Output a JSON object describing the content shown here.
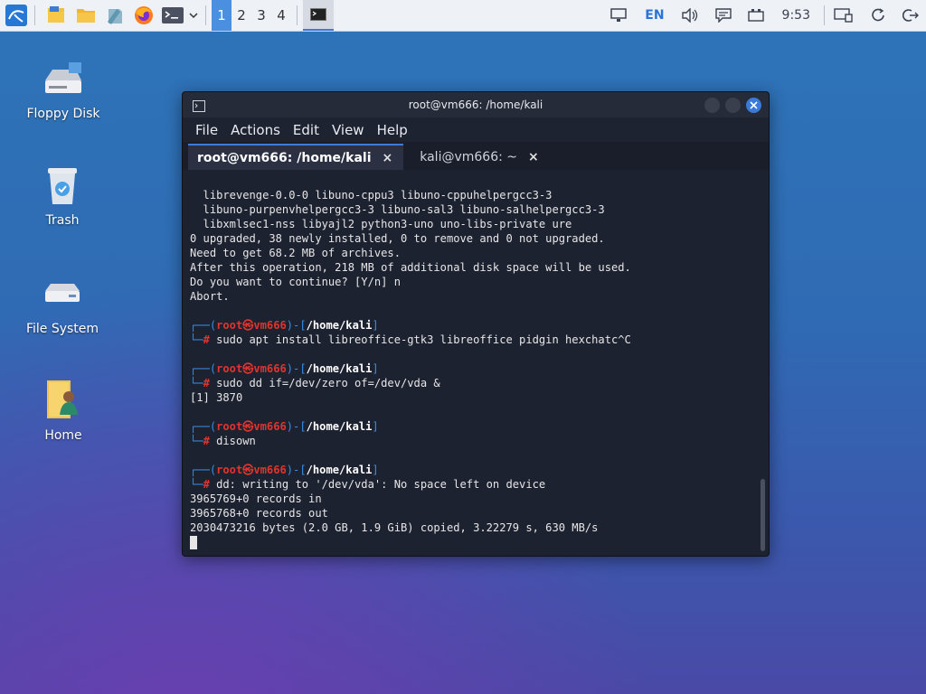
{
  "taskbar": {
    "workspaces": [
      "1",
      "2",
      "3",
      "4"
    ],
    "active_workspace": "1",
    "language": "EN",
    "clock": "9:53"
  },
  "desktop": {
    "icons": [
      {
        "label": "Floppy Disk"
      },
      {
        "label": "Trash"
      },
      {
        "label": "File System"
      },
      {
        "label": "Home"
      }
    ]
  },
  "window": {
    "title": "root@vm666: /home/kali",
    "menu": [
      "File",
      "Actions",
      "Edit",
      "View",
      "Help"
    ],
    "tabs": [
      {
        "label": "root@vm666: /home/kali",
        "close": "×"
      },
      {
        "label": "kali@vm666: ~",
        "close": "×"
      }
    ]
  },
  "terminal": {
    "output1": [
      "  librevenge-0.0-0 libuno-cppu3 libuno-cppuhelpergcc3-3",
      "  libuno-purpenvhelpergcc3-3 libuno-sal3 libuno-salhelpergcc3-3",
      "  libxmlsec1-nss libyajl2 python3-uno uno-libs-private ure",
      "0 upgraded, 38 newly installed, 0 to remove and 0 not upgraded.",
      "Need to get 68.2 MB of archives.",
      "After this operation, 218 MB of additional disk space will be used.",
      "Do you want to continue? [Y/n] n",
      "Abort."
    ],
    "prompt_user": "root",
    "prompt_skull": "㉿",
    "prompt_host": "vm666",
    "prompt_path": "/home/kali",
    "prompt_hash": "#",
    "commands": [
      {
        "cmd": "sudo apt install libreoffice-gtk3 libreoffice pidgin hexchatc^C",
        "out": []
      },
      {
        "cmd": "sudo dd if=/dev/zero of=/dev/vda &",
        "out": [
          "[1] 3870"
        ]
      },
      {
        "cmd": "disown",
        "out": []
      },
      {
        "cmd": "dd: writing to '/dev/vda': No space left on device",
        "out": [
          "3965769+0 records in",
          "3965768+0 records out",
          "2030473216 bytes (2.0 GB, 1.9 GiB) copied, 3.22279 s, 630 MB/s"
        ]
      }
    ]
  }
}
